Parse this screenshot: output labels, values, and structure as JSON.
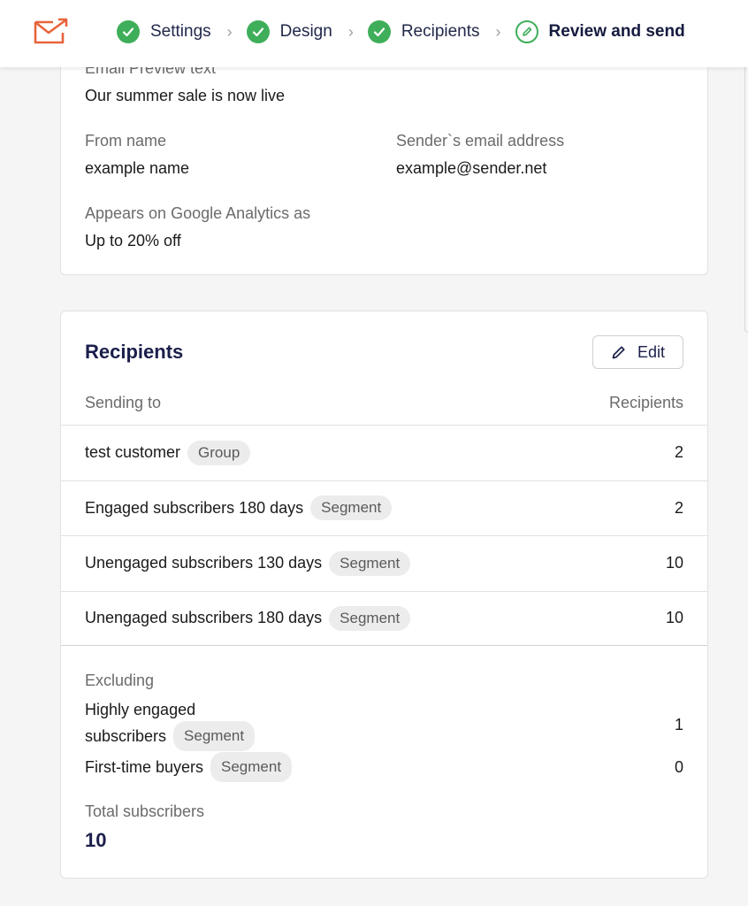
{
  "header": {
    "steps": [
      {
        "label": "Settings",
        "status": "done"
      },
      {
        "label": "Design",
        "status": "done"
      },
      {
        "label": "Recipients",
        "status": "done"
      },
      {
        "label": "Review and send",
        "status": "current"
      }
    ],
    "separator": "›"
  },
  "details": {
    "preview_text_label": "Email Preview text",
    "preview_text_value": "Our summer sale is now live",
    "from_name_label": "From name",
    "from_name_value": "example name",
    "sender_email_label": "Sender`s email address",
    "sender_email_value": "example@sender.net",
    "analytics_label": "Appears on Google Analytics as",
    "analytics_value": "Up to 20% off"
  },
  "recipients": {
    "title": "Recipients",
    "edit_label": "Edit",
    "col_sending_to": "Sending to",
    "col_recipients": "Recipients",
    "rows": [
      {
        "name": "test customer",
        "type": "Group",
        "count": "2"
      },
      {
        "name": "Engaged subscribers 180 days",
        "type": "Segment",
        "count": "2"
      },
      {
        "name": "Unengaged subscribers 130 days",
        "type": "Segment",
        "count": "10"
      },
      {
        "name": "Unengaged subscribers 180 days",
        "type": "Segment",
        "count": "10"
      }
    ],
    "excluding_label": "Excluding",
    "excluded": [
      {
        "name_line1": "Highly engaged",
        "name_line2": "subscribers",
        "type": "Segment",
        "count": "1"
      },
      {
        "name_line1": "First-time buyers",
        "type": "Segment",
        "count": "0"
      }
    ],
    "total_label": "Total subscribers",
    "total_value": "10"
  },
  "colors": {
    "accent_green": "#3fae5a",
    "logo_orange": "#e8643c",
    "title_navy": "#1b1f4b"
  }
}
